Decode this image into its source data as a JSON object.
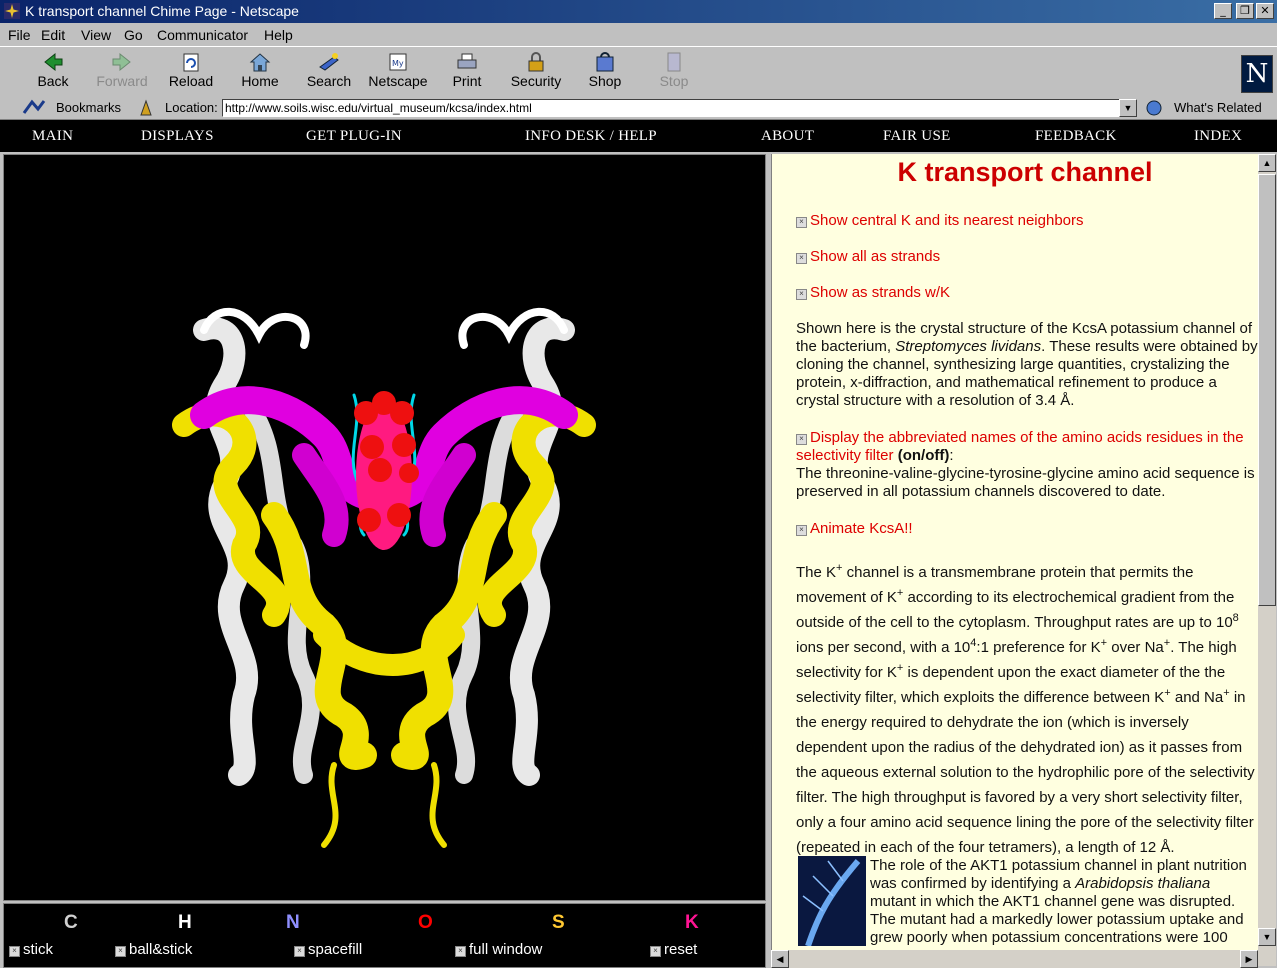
{
  "window": {
    "title": "K transport channel Chime Page - Netscape",
    "min": "_",
    "max": "❐",
    "close": "✕"
  },
  "menu": [
    "File",
    "Edit",
    "View",
    "Go",
    "Communicator",
    "Help"
  ],
  "toolbar": {
    "buttons": [
      {
        "label": "Back",
        "icon": "back-arrow-icon",
        "enabled": true
      },
      {
        "label": "Forward",
        "icon": "forward-arrow-icon",
        "enabled": false
      },
      {
        "label": "Reload",
        "icon": "reload-icon",
        "enabled": true
      },
      {
        "label": "Home",
        "icon": "home-icon",
        "enabled": true
      },
      {
        "label": "Search",
        "icon": "search-icon",
        "enabled": true
      },
      {
        "label": "Netscape",
        "icon": "netscape-icon",
        "enabled": true
      },
      {
        "label": "Print",
        "icon": "print-icon",
        "enabled": true
      },
      {
        "label": "Security",
        "icon": "lock-icon",
        "enabled": true
      },
      {
        "label": "Shop",
        "icon": "shop-icon",
        "enabled": true
      },
      {
        "label": "Stop",
        "icon": "stop-icon",
        "enabled": false
      }
    ],
    "logo": "N"
  },
  "location": {
    "bookmarks_label": "Bookmarks",
    "location_label": "Location:",
    "url": "http://www.soils.wisc.edu/virtual_museum/kcsa/index.html",
    "whats_related": "What's Related"
  },
  "nav": [
    "MAIN",
    "DISPLAYS",
    "GET PLUG-IN",
    "INFO DESK / HELP",
    "ABOUT",
    "FAIR USE",
    "FEEDBACK",
    "INDEX"
  ],
  "legend": {
    "elements": [
      {
        "symbol": "C",
        "color": "#d0d0d0"
      },
      {
        "symbol": "H",
        "color": "#ffffff"
      },
      {
        "symbol": "N",
        "color": "#8f8fff"
      },
      {
        "symbol": "O",
        "color": "#ff0000"
      },
      {
        "symbol": "S",
        "color": "#ffc832"
      },
      {
        "symbol": "K",
        "color": "#ff1493"
      }
    ],
    "options": [
      "stick",
      "ball&stick",
      "spacefill",
      "full window",
      "reset"
    ]
  },
  "info": {
    "title": "K transport channel",
    "link1": "Show central K and its nearest neighbors",
    "link2": "Show all as strands",
    "link3": "Show as strands w/K",
    "para1_a": "Shown here is the crystal structure of the KcsA potassium channel of the bacterium, ",
    "para1_species": "Streptomyces lividans",
    "para1_b": ". These results were obtained by cloning the channel, synthesizing large quantities, crystalizing the protein, x-diffraction, and mathematical refinement to produce a crystal structure with a resolution of 3.4 Å.",
    "link4": "Display the abbreviated names of the amino acids residues in the selectivity filter",
    "onoff": "(on/off)",
    "para2": "The threonine-valine-glycine-tyrosine-glycine amino acid sequence is preserved in all potassium channels discovered to date.",
    "link5": "Animate KcsA!!",
    "p3": {
      "t1": "The K",
      "t2": " channel is a transmembrane protein that permits the movement of K",
      "t3": " according to its electrochemical gradient from the outside of the cell to the cytoplasm. Throughput rates are up to 10",
      "t4": " ions per second, with a 10",
      "t5": ":1 preference for K",
      "t6": " over Na",
      "t7": ". The high selectivity for K",
      "t8": " is dependent upon the exact diameter of the the selectivity filter, which exploits the difference between K",
      "t9": " and Na",
      "t10": " in the energy required to dehydrate the ion (which is inversely dependent upon the radius of the dehydrated ion) as it passes from the aqueous external solution to the hydrophilic pore of the selectivity filter. The high throughput is favored by a very short selectivity filter, only a four amino acid sequence lining the pore of the selectivity filter (repeated in each of the four tetramers), a length of 12 Å.",
      "plus": "+",
      "exp8": "8",
      "exp4": "4"
    },
    "para4_a": "The role of the AKT1 potassium channel in plant nutrition was confirmed by identifying a ",
    "para4_species": "Arabidopsis thaliana",
    "para4_b": " mutant in which the AKT1 channel gene was disrupted. The mutant had a markedly lower potassium uptake and grew poorly when potassium concentrations were 100"
  }
}
